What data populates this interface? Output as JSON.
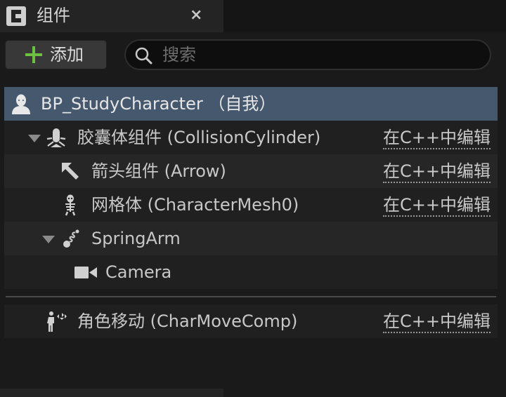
{
  "tab": {
    "title": "组件",
    "icon": "blueprint-components-icon",
    "close_label": "×"
  },
  "toolbar": {
    "add_label": "添加",
    "add_icon": "plus-icon",
    "search_placeholder": "搜索",
    "search_value": "",
    "plus_color": "#6cc240"
  },
  "tree": {
    "selected_color": "#45586e",
    "root": {
      "label": "BP_StudyCharacter （自我）",
      "icon": "character-icon"
    },
    "items": [
      {
        "label": "胶囊体组件 (CollisionCylinder)",
        "icon": "capsule-collision-icon",
        "action": "在C++中编辑",
        "expanded": true
      },
      {
        "label": "箭头组件 (Arrow)",
        "icon": "arrow-component-icon",
        "action": "在C++中编辑"
      },
      {
        "label": "网格体 (CharacterMesh0)",
        "icon": "skeletal-mesh-icon",
        "action": "在C++中编辑"
      },
      {
        "label": "SpringArm",
        "icon": "spring-arm-icon",
        "expanded": true
      },
      {
        "label": "Camera",
        "icon": "camera-icon"
      }
    ],
    "movement": {
      "label": "角色移动 (CharMoveComp)",
      "icon": "character-movement-icon",
      "action": "在C++中编辑"
    }
  }
}
